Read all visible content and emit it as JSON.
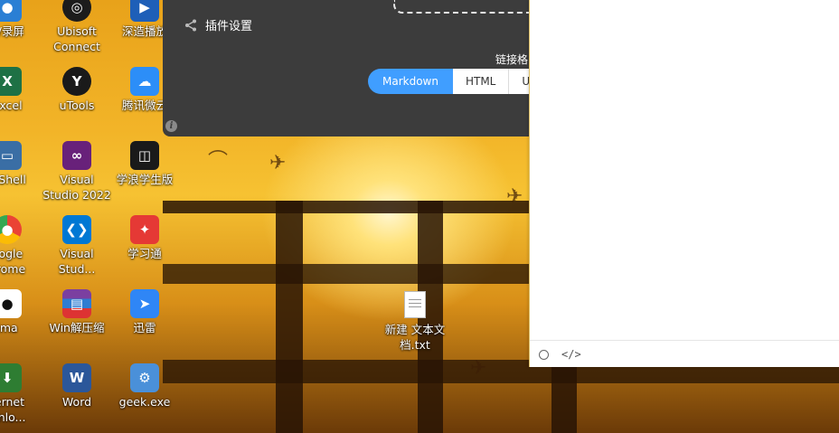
{
  "desktop": {
    "icons": [
      {
        "label": "V/录屏",
        "icon": "recorder-icon",
        "color": "#2a7fd4"
      },
      {
        "label": "Ubisoft Connect",
        "icon": "ubisoft-icon",
        "color": "#1c1c1c"
      },
      {
        "label": "深造播放",
        "icon": "player-icon",
        "color": "#1e5fb8"
      },
      {
        "label": "Excel",
        "icon": "excel-icon",
        "color": "#1e7145"
      },
      {
        "label": "uTools",
        "icon": "utools-icon",
        "color": "#1a1a1a"
      },
      {
        "label": "腾讯微云",
        "icon": "weiyun-icon",
        "color": "#2c8ef8"
      },
      {
        "label": "alShell",
        "icon": "shell-icon",
        "color": "#3a6ea5"
      },
      {
        "label": "Visual Studio 2022",
        "icon": "visual-studio-icon",
        "color": "#68217a"
      },
      {
        "label": "学浪学生版",
        "icon": "xuelang-icon",
        "color": "#1a1a1a"
      },
      {
        "label": "oogle hrome",
        "icon": "chrome-icon",
        "color": "#4285f4"
      },
      {
        "label": "Visual Stud...",
        "icon": "vscode-icon",
        "color": "#0078d4"
      },
      {
        "label": "学习通",
        "icon": "xuexitong-icon",
        "color": "#e53935"
      },
      {
        "label": "ima",
        "icon": "panda-icon",
        "color": "#ffffff"
      },
      {
        "label": "Win解压缩",
        "icon": "winrar-icon",
        "color": "#7b3fa0"
      },
      {
        "label": "迅雷",
        "icon": "xunlei-icon",
        "color": "#2f86f6"
      },
      {
        "label": "ternet wnlo...",
        "icon": "idm-icon",
        "color": "#2e7d32"
      },
      {
        "label": "Word",
        "icon": "word-icon",
        "color": "#2b579a"
      },
      {
        "label": "geek.exe",
        "icon": "geek-icon",
        "color": "#4a90d9"
      }
    ],
    "file": {
      "label": "新建 文本文档.txt",
      "icon": "text-file-icon"
    }
  },
  "panel": {
    "plugin_settings": "插件设置",
    "link_format_label": "链接格",
    "formats": [
      "Markdown",
      "HTML",
      "UI"
    ],
    "accent": "#409eff"
  },
  "pane": {
    "code_glyph": "</>"
  }
}
